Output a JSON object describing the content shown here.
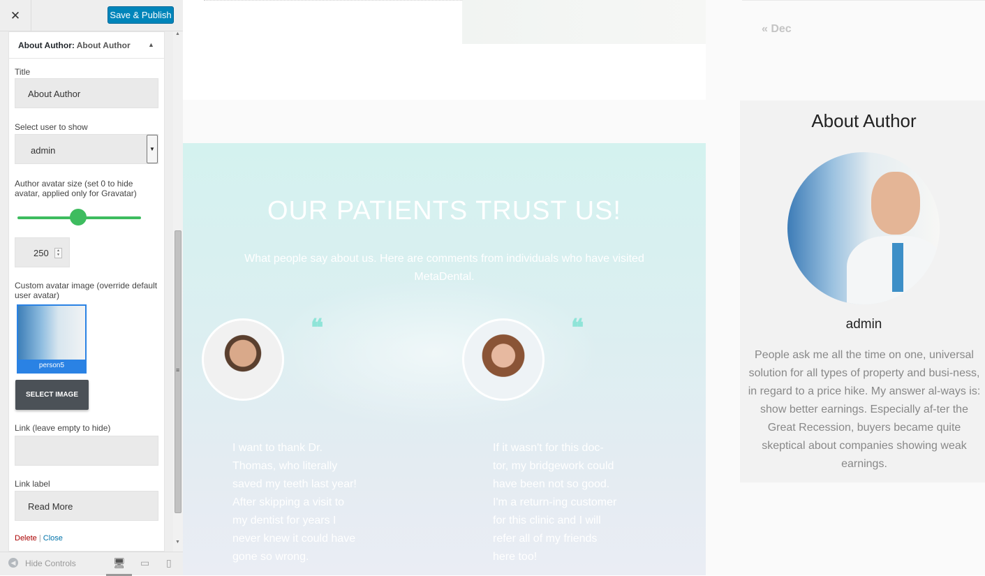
{
  "header": {
    "close_icon": "close-icon",
    "publish_label": "Save & Publish"
  },
  "widget": {
    "title_prefix": "About Author:",
    "title_value": "About Author",
    "title_label": "Title",
    "title_value_field": "About Author",
    "user_label": "Select user to show",
    "user_value": "admin",
    "avatar_size_label": "Author avatar size (set 0 to hide avatar, applied only for Gravatar)",
    "avatar_size_value": "250",
    "slider_fraction": 0.49,
    "custom_avatar_label": "Custom avatar image (override default user avatar)",
    "image_name": "person5",
    "select_image_label": "SELECT IMAGE",
    "link_label": "Link (leave empty to hide)",
    "link_value": "",
    "link_label_label": "Link label",
    "link_label_value": "Read More",
    "delete_label": "Delete",
    "separator": "|",
    "close_label": "Close"
  },
  "footer": {
    "hide_controls_label": "Hide Controls"
  },
  "preview": {
    "trust_title": "OUR PATIENTS TRUST US!",
    "trust_subtitle": "What people say about us. Here are comments from individuals who have visited MetaDental.",
    "quote_mark": "❝",
    "testimonials": [
      {
        "text": "I want to thank Dr. Thomas, who literally saved my teeth last year! After skipping a visit to my dentist for years I never knew it could have gone so wrong."
      },
      {
        "text": "If it wasn't for this doc-tor, my bridgework could have been not so good. I'm a return-ing customer for this clinic and I will refer all of my friends here too!"
      }
    ],
    "calendar_prev": "« Dec",
    "author_widget": {
      "title": "About Author",
      "name": "admin",
      "bio": "People ask me all the time on one, universal solution for all types of property and busi-ness, in regard to a price hike. My answer al-ways is: show better earnings. Especially af-ter the Great Recession, buyers became quite skeptical about companies showing weak earnings."
    }
  }
}
